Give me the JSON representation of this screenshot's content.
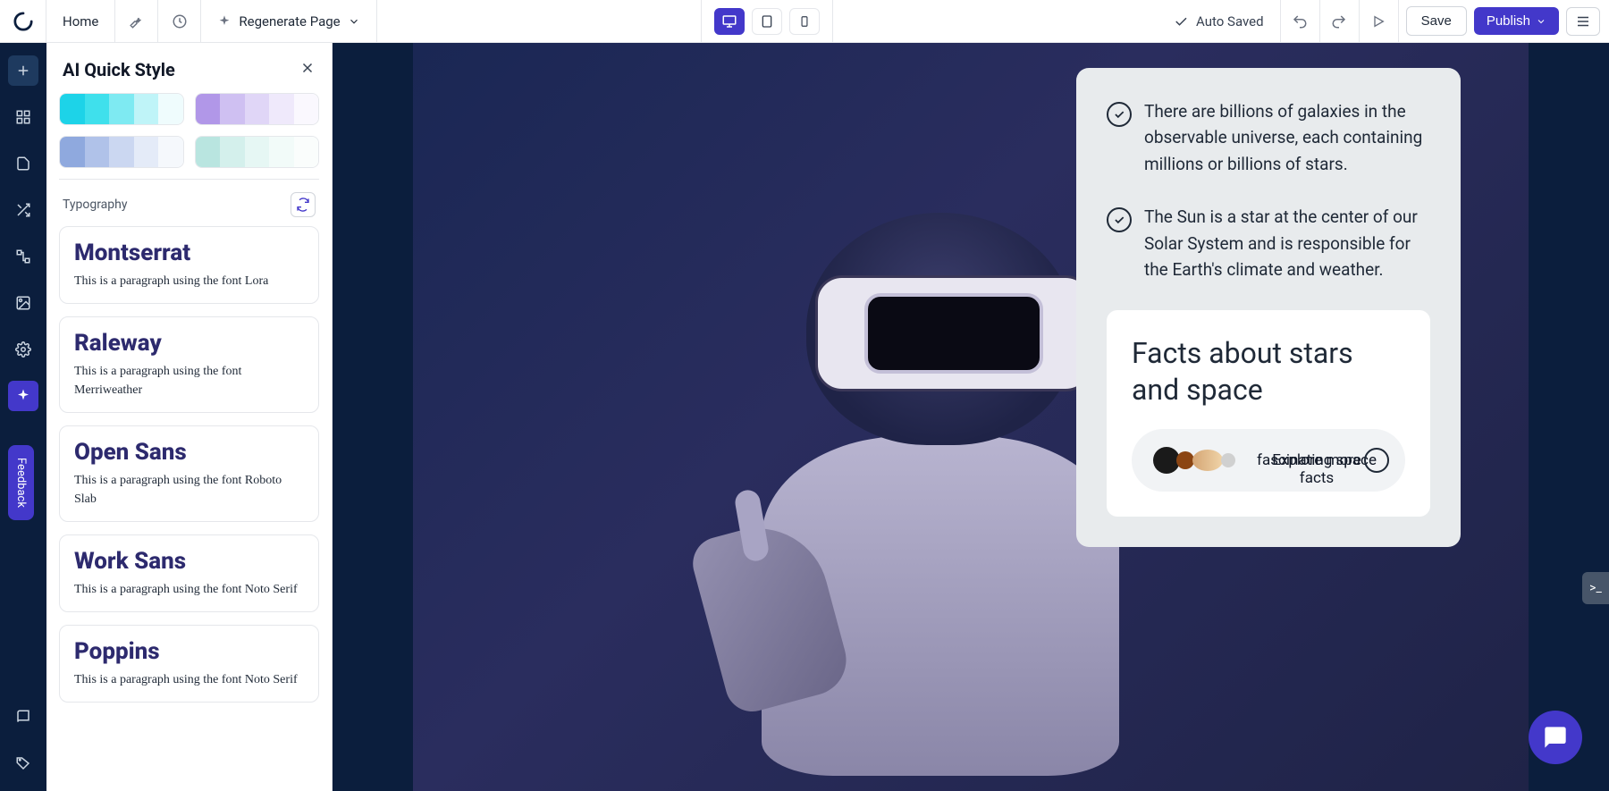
{
  "topbar": {
    "home": "Home",
    "regenerate": "Regenerate Page",
    "autosaved": "Auto Saved",
    "save": "Save",
    "publish": "Publish"
  },
  "panel": {
    "title": "AI Quick Style",
    "typography_label": "Typography",
    "palettes": {
      "row1": [
        [
          "#1dd3e8",
          "#3fe0ec",
          "#7eeaf2",
          "#bff4f8",
          "#effcfd"
        ],
        [
          "#b197e8",
          "#cfc0f2",
          "#e0d6f7",
          "#efe9fb",
          "#faf8fe"
        ]
      ],
      "row2": [
        [
          "#8fa9de",
          "#b0c2e9",
          "#cbd7f1",
          "#e4ebf8",
          "#f5f8fc"
        ],
        [
          "#b9e5e0",
          "#d4f0ec",
          "#e6f7f4",
          "#f2fbf9",
          "#fafdfc"
        ]
      ]
    },
    "fonts": [
      {
        "name": "Montserrat",
        "sample": "This is a paragraph using the font Lora"
      },
      {
        "name": "Raleway",
        "sample": "This is a paragraph using the font Merriweather"
      },
      {
        "name": "Open Sans",
        "sample": "This is a paragraph using the font Roboto Slab"
      },
      {
        "name": "Work Sans",
        "sample": "This is a paragraph using the font Noto Serif"
      },
      {
        "name": "Poppins",
        "sample": "This is a paragraph using the font Noto Serif"
      }
    ]
  },
  "canvas": {
    "facts": [
      "There are billions of galaxies in the observable universe, each containing millions or billions of stars.",
      "The Sun is a star at the center of our Solar System and is responsible for the Earth's climate and weather."
    ],
    "card_title": "Facts about stars and space",
    "pill_text_a": "Explore more",
    "pill_text_b": "fascinating space facts"
  },
  "feedback": "Feedback"
}
